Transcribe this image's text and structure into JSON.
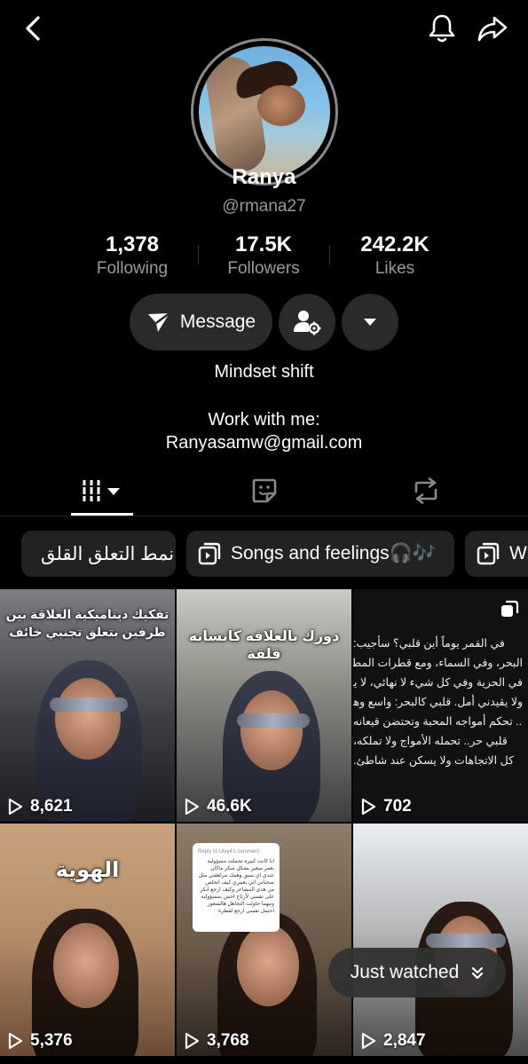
{
  "header": {
    "back_icon": "chevron-left-icon",
    "notifications_icon": "bell-icon",
    "share_icon": "share-arrow-icon"
  },
  "profile": {
    "name": "Ranya",
    "handle": "@rmana27",
    "stats": {
      "following": {
        "value": "1,378",
        "label": "Following"
      },
      "followers": {
        "value": "17.5K",
        "label": "Followers"
      },
      "likes": {
        "value": "242.2K",
        "label": "Likes"
      }
    },
    "actions": {
      "message_label": "Message"
    },
    "bio_line1": "Mindset shift",
    "bio_line2": "Work with me:",
    "bio_line3": "Ranyasamw@gmail.com"
  },
  "tabs": [
    {
      "name": "videos",
      "icon": "grid-bars-icon",
      "active": true
    },
    {
      "name": "favorites",
      "icon": "sticker-icon",
      "active": false
    },
    {
      "name": "reposts",
      "icon": "repost-icon",
      "active": false
    }
  ],
  "playlists": [
    {
      "label": "نمط التعلق القلق"
    },
    {
      "label": "Songs and feelings🎧🎶"
    },
    {
      "label": "Wr"
    }
  ],
  "videos": [
    {
      "views": "8,621",
      "overlay": "تفكيك ديناميكية العلاقة بين طرفين بتعلق تجنبي خائف"
    },
    {
      "views": "46.6K",
      "overlay": "دورك بالعلاقه كانسانه قلقة"
    },
    {
      "views": "702",
      "text_lines": [
        "في القمر يوماً أين قلبي؟ سأجيب:",
        "البحر، وفي السماء، ومع قطرات المطر، أجد",
        "في الحرية وفي كل شيء لا نهائي، لا يحدّني",
        "ولا يقيدني أمل. قلبي كالبحر: واسع وهادئ",
        ".. تحكم أمواجه المحبة وتحتضن قيعانه",
        "قلبي حر.. تحمله الأمواج ولا تملكه،",
        "كل الاتجاهات ولا يسكن عند شاطئ."
      ]
    },
    {
      "views": "5,376",
      "overlay": "الهوية"
    },
    {
      "views": "3,768",
      "comment_title": "Reply to Ulvy4's comment",
      "comment_body": "انا كانت كبيره تحملت مسؤولية بعمر صغير بشكل مبكر ماكان عندي اي سبق وهمك مراهقتي مثل صحباتي اني بعمري كيف اتخلص من هذي المشاعر وكيف ارجع ابكر على نفسي لأرتاح احس بمسؤولية ومهما حاولت التجاهل هالشعور احتمل نفسي ارجع لفطرة"
    },
    {
      "views": "2,847"
    }
  ],
  "just_watched_label": "Just watched"
}
